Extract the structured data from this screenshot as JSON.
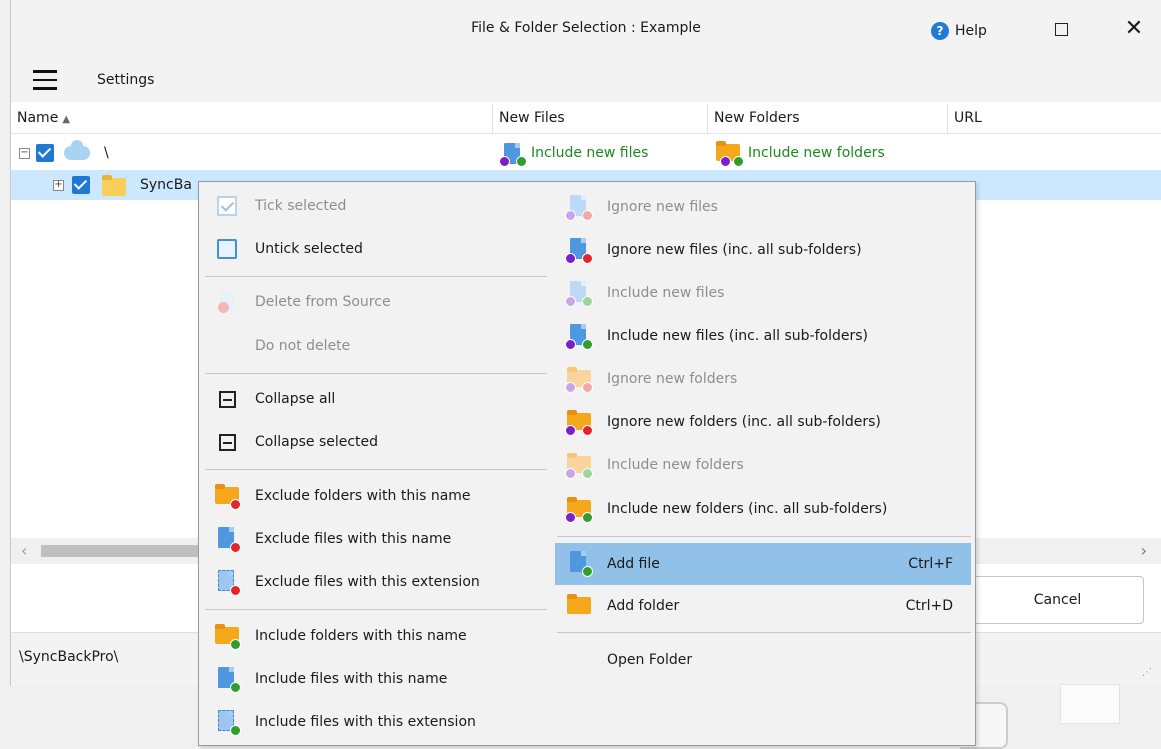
{
  "window": {
    "title": "File & Folder Selection : Example",
    "help_label": "Help",
    "close_label": "✕"
  },
  "toolbar": {
    "settings_label": "Settings"
  },
  "grid": {
    "columns": [
      "Name",
      "New Files",
      "New Folders",
      "URL"
    ],
    "rows": [
      {
        "name": "\\",
        "new_files": "Include new files",
        "new_folders": "Include new folders"
      },
      {
        "name": "SyncBa"
      }
    ]
  },
  "buttons": {
    "cancel_label": "Cancel"
  },
  "status": {
    "path": "\\SyncBackPro\\"
  },
  "context_menu": {
    "left": [
      "Tick selected",
      "Untick selected",
      "Delete from Source",
      "Do not delete",
      "Collapse all",
      "Collapse selected",
      "Exclude folders with this name",
      "Exclude files with this name",
      "Exclude files with this extension",
      "Include folders with this name",
      "Include files with this name",
      "Include files with this extension"
    ],
    "right": [
      "Ignore new files",
      "Ignore new files (inc. all sub-folders)",
      "Include new files",
      "Include new files (inc. all sub-folders)",
      "Ignore new folders",
      "Ignore new folders (inc. all sub-folders)",
      "Include new folders",
      "Include new folders (inc. all sub-folders)",
      "Add file",
      "Add folder",
      "Open Folder"
    ],
    "shortcuts": {
      "add_file": "Ctrl+F",
      "add_folder": "Ctrl+D"
    }
  },
  "colors": {
    "accent": "#1d79d4",
    "selected_row": "#cce8ff",
    "menu_highlight": "#91c1e9",
    "include_green": "#1a8a1a"
  }
}
